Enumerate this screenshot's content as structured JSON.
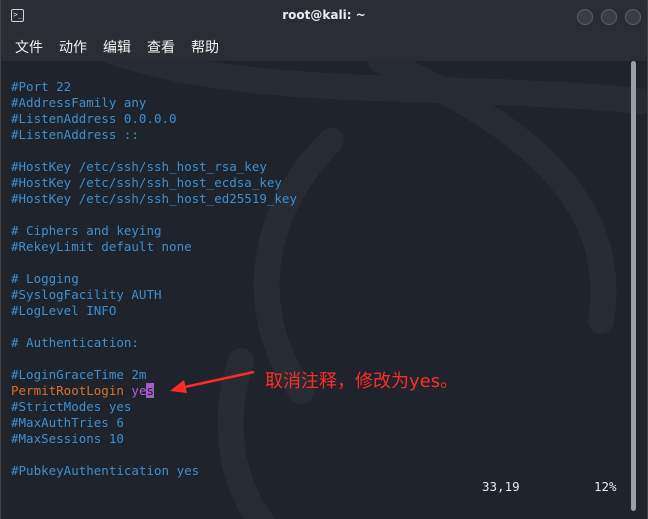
{
  "window": {
    "title": "root@kali: ~",
    "icon": "terminal-icon"
  },
  "menu": {
    "items": [
      "文件",
      "动作",
      "编辑",
      "查看",
      "帮助"
    ]
  },
  "editor": {
    "lines": [
      "#Port 22",
      "#AddressFamily any",
      "#ListenAddress 0.0.0.0",
      "#ListenAddress ::",
      "",
      "#HostKey /etc/ssh/ssh_host_rsa_key",
      "#HostKey /etc/ssh/ssh_host_ecdsa_key",
      "#HostKey /etc/ssh/ssh_host_ed25519_key",
      "",
      "# Ciphers and keying",
      "#RekeyLimit default none",
      "",
      "# Logging",
      "#SyslogFacility AUTH",
      "#LogLevel INFO",
      "",
      "# Authentication:",
      "",
      "#LoginGraceTime 2m",
      "",
      "#StrictModes yes",
      "#MaxAuthTries 6",
      "#MaxSessions 10",
      "",
      "#PubkeyAuthentication yes"
    ],
    "active_line": {
      "key": "PermitRootLogin",
      "value_head": "ye",
      "cursor_char": "s"
    },
    "status": {
      "position": "33,19",
      "percent": "12%"
    }
  },
  "annotation": {
    "text": "取消注释，修改为yes。",
    "color": "#ff2b2b"
  },
  "colors": {
    "comment": "#3d8fd0",
    "keyword": "#e06d25",
    "value": "#b061d6",
    "cursor": "#a15cc7",
    "background": "#1f232b"
  }
}
